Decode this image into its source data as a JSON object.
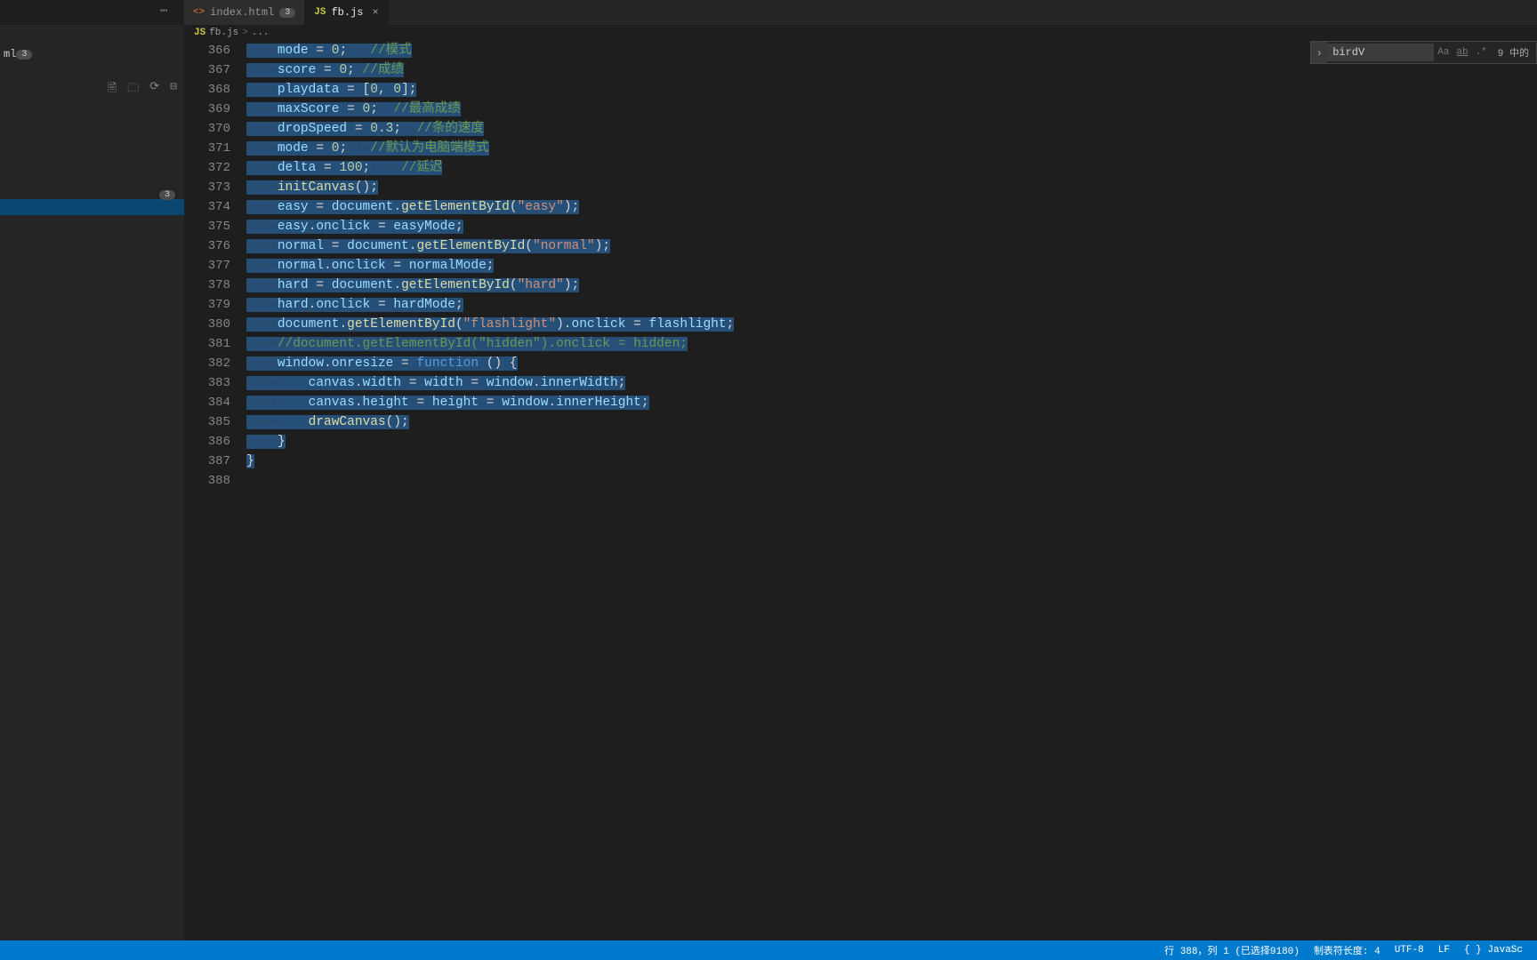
{
  "tabs": [
    {
      "label": "index.html",
      "icon": "<>",
      "iconClass": "html",
      "badge": "3",
      "active": false
    },
    {
      "label": "fb.js",
      "icon": "JS",
      "iconClass": "js",
      "badge": null,
      "active": true
    }
  ],
  "breadcrumb": {
    "icon": "JS",
    "file": "fb.js",
    "sep": ">",
    "rest": "..."
  },
  "sidebar": {
    "item_ml": "ml",
    "badge_ml": "3",
    "badge_other": "3"
  },
  "find": {
    "value": "birdV",
    "result": "9 中的"
  },
  "code": {
    "start": 366,
    "lines": [
      [
        [
          "v",
          "mode"
        ],
        [
          "o",
          " = "
        ],
        [
          "n",
          "0"
        ],
        [
          "o",
          ";"
        ],
        [
          "ws",
          "···"
        ],
        [
          "c",
          "//模式"
        ]
      ],
      [
        [
          "v",
          "score"
        ],
        [
          "o",
          " = "
        ],
        [
          "n",
          "0"
        ],
        [
          "o",
          ";"
        ],
        [
          "o",
          " "
        ],
        [
          "c",
          "//成绩"
        ]
      ],
      [
        [
          "v",
          "playdata"
        ],
        [
          "o",
          " = ["
        ],
        [
          "n",
          "0"
        ],
        [
          "o",
          ", "
        ],
        [
          "n",
          "0"
        ],
        [
          "o",
          "];"
        ]
      ],
      [
        [
          "v",
          "maxScore"
        ],
        [
          "o",
          " = "
        ],
        [
          "n",
          "0"
        ],
        [
          "o",
          ";"
        ],
        [
          "o",
          "  "
        ],
        [
          "c",
          "//最高成绩"
        ]
      ],
      [
        [
          "v",
          "dropSpeed"
        ],
        [
          "o",
          " = "
        ],
        [
          "n",
          "0.3"
        ],
        [
          "o",
          ";"
        ],
        [
          "ws",
          "··"
        ],
        [
          "c",
          "//条的速度"
        ]
      ],
      [
        [
          "v",
          "mode"
        ],
        [
          "o",
          " = "
        ],
        [
          "n",
          "0"
        ],
        [
          "o",
          ";"
        ],
        [
          "ws",
          "···"
        ],
        [
          "c",
          "//默认为电脑端模式"
        ]
      ],
      [
        [
          "v",
          "delta"
        ],
        [
          "o",
          " = "
        ],
        [
          "n",
          "100"
        ],
        [
          "o",
          ";"
        ],
        [
          "ws",
          "····"
        ],
        [
          "c",
          "//延迟"
        ]
      ],
      [
        [
          "f",
          "initCanvas"
        ],
        [
          "o",
          "();"
        ]
      ],
      [
        [
          "v",
          "easy"
        ],
        [
          "o",
          " = "
        ],
        [
          "v",
          "document"
        ],
        [
          "o",
          "."
        ],
        [
          "f",
          "getElementById"
        ],
        [
          "o",
          "("
        ],
        [
          "s",
          "\"easy\""
        ],
        [
          "o",
          ");"
        ]
      ],
      [
        [
          "v",
          "easy"
        ],
        [
          "o",
          "."
        ],
        [
          "v",
          "onclick"
        ],
        [
          "o",
          " = "
        ],
        [
          "v",
          "easyMode"
        ],
        [
          "o",
          ";"
        ]
      ],
      [
        [
          "v",
          "normal"
        ],
        [
          "o",
          " = "
        ],
        [
          "v",
          "document"
        ],
        [
          "o",
          "."
        ],
        [
          "f",
          "getElementById"
        ],
        [
          "o",
          "("
        ],
        [
          "s",
          "\"normal\""
        ],
        [
          "o",
          ");"
        ]
      ],
      [
        [
          "v",
          "normal"
        ],
        [
          "o",
          "."
        ],
        [
          "v",
          "onclick"
        ],
        [
          "o",
          " = "
        ],
        [
          "v",
          "normalMode"
        ],
        [
          "o",
          ";"
        ]
      ],
      [
        [
          "v",
          "hard"
        ],
        [
          "o",
          " = "
        ],
        [
          "v",
          "document"
        ],
        [
          "o",
          "."
        ],
        [
          "f",
          "getElementById"
        ],
        [
          "o",
          "("
        ],
        [
          "s",
          "\"hard\""
        ],
        [
          "o",
          ");"
        ]
      ],
      [
        [
          "v",
          "hard"
        ],
        [
          "o",
          "."
        ],
        [
          "v",
          "onclick"
        ],
        [
          "o",
          " = "
        ],
        [
          "v",
          "hardMode"
        ],
        [
          "o",
          ";"
        ]
      ],
      [
        [
          "v",
          "document"
        ],
        [
          "o",
          "."
        ],
        [
          "f",
          "getElementById"
        ],
        [
          "o",
          "("
        ],
        [
          "s",
          "\"flashlight\""
        ],
        [
          "o",
          ")."
        ],
        [
          "v",
          "onclick"
        ],
        [
          "o",
          " = "
        ],
        [
          "v",
          "flashlight"
        ],
        [
          "o",
          ";"
        ]
      ],
      [
        [
          "c",
          "//document.getElementById(\"hidden\").onclick = hidden;"
        ]
      ],
      [
        [
          "v",
          "window"
        ],
        [
          "o",
          "."
        ],
        [
          "v",
          "onresize"
        ],
        [
          "o",
          " = "
        ],
        [
          "k",
          "function"
        ],
        [
          "o",
          " () {"
        ]
      ],
      [
        [
          "o",
          "    "
        ],
        [
          "v",
          "canvas"
        ],
        [
          "o",
          "."
        ],
        [
          "v",
          "width"
        ],
        [
          "o",
          " = "
        ],
        [
          "v",
          "width"
        ],
        [
          "o",
          " = "
        ],
        [
          "v",
          "window"
        ],
        [
          "o",
          "."
        ],
        [
          "v",
          "innerWidth"
        ],
        [
          "o",
          ";"
        ]
      ],
      [
        [
          "o",
          "    "
        ],
        [
          "v",
          "canvas"
        ],
        [
          "o",
          "."
        ],
        [
          "v",
          "height"
        ],
        [
          "o",
          " = "
        ],
        [
          "v",
          "height"
        ],
        [
          "o",
          " = "
        ],
        [
          "v",
          "window"
        ],
        [
          "o",
          "."
        ],
        [
          "v",
          "innerHeight"
        ],
        [
          "o",
          ";"
        ]
      ],
      [
        [
          "o",
          "    "
        ],
        [
          "f",
          "drawCanvas"
        ],
        [
          "o",
          "();"
        ]
      ],
      [
        [
          "o",
          "}"
        ]
      ],
      [
        [
          "o2",
          "}"
        ]
      ],
      [
        [
          "empty",
          ""
        ]
      ]
    ],
    "indent": "    "
  },
  "status": {
    "cursor": "行 388，列 1 (已选择9180)",
    "tabsize": "制表符长度: 4",
    "encoding": "UTF-8",
    "eol": "LF",
    "lang_icon": "{ }",
    "lang": "JavaSc"
  }
}
